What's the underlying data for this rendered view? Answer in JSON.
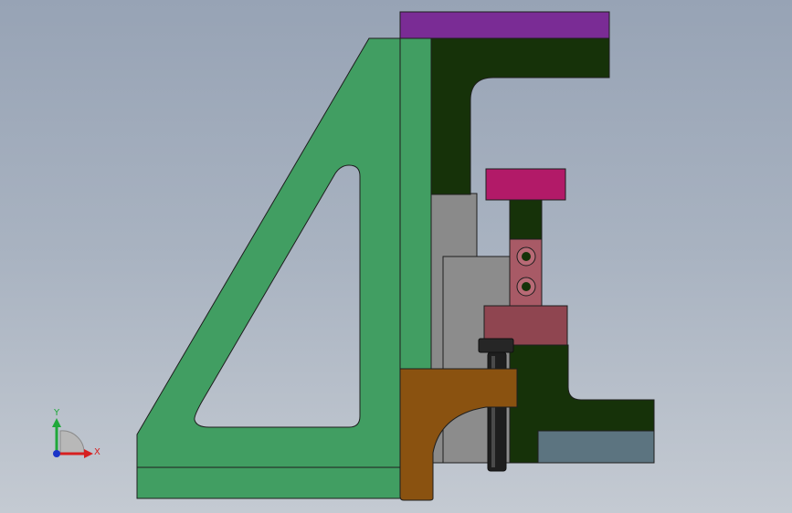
{
  "viewport": {
    "background_top": "#97a3b5",
    "background_bottom": "#c4cad2"
  },
  "model": {
    "parts": [
      {
        "name": "green-base-plate",
        "color": "#419e62"
      },
      {
        "name": "purple-top-plate",
        "color": "#7a2c95"
      },
      {
        "name": "dark-green-column",
        "color": "#163209"
      },
      {
        "name": "magenta-cap",
        "color": "#b21a68"
      },
      {
        "name": "pink-clamp-block",
        "color": "#a85a66"
      },
      {
        "name": "red-slide-block",
        "color": "#8f4550"
      },
      {
        "name": "brown-bracket",
        "color": "#8a5210"
      },
      {
        "name": "gray-spacer-block",
        "color": "#8a8a8a"
      },
      {
        "name": "black-bolt",
        "color": "#1e1e1e"
      },
      {
        "name": "slate-base-block",
        "color": "#5c7480"
      }
    ]
  },
  "triad": {
    "x_label": "X",
    "y_label": "Y",
    "x_color": "#d62020",
    "y_color": "#1fa83a",
    "z_color": "#1a34c8"
  }
}
